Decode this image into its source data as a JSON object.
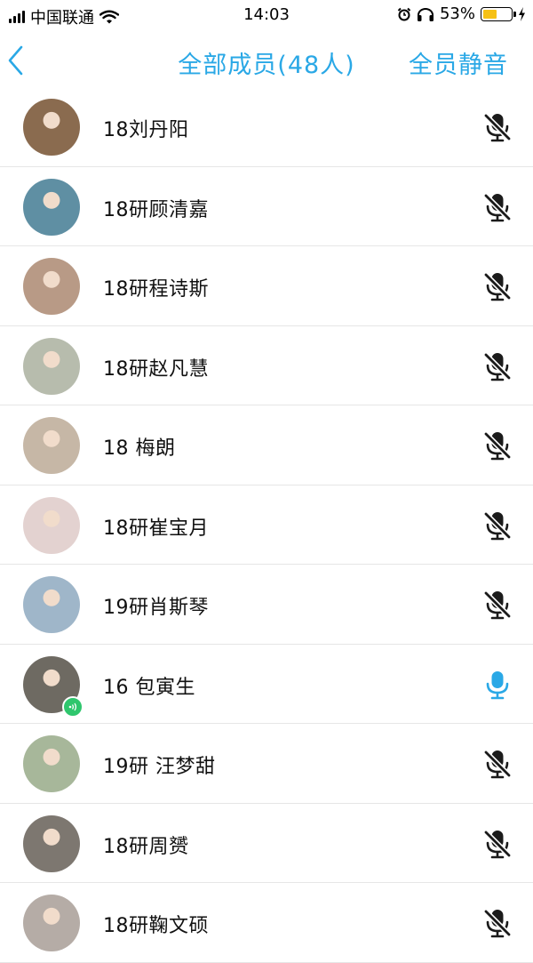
{
  "status_bar": {
    "carrier": "中国联通",
    "time": "14:03",
    "battery_percent": "53%",
    "battery_level": 0.53,
    "battery_color": "#f6c115",
    "icons": [
      "signal-icon",
      "wifi-icon",
      "alarm-icon",
      "headphones-icon",
      "battery-icon",
      "charging-bolt-icon"
    ]
  },
  "nav": {
    "back_icon": "chevron-left-icon",
    "title": "全部成员(48人)",
    "action_label": "全员静音",
    "accent_color": "#2aa8e6"
  },
  "members": [
    {
      "name": "18刘丹阳",
      "mic": "muted",
      "avatar_color": "#8a6b4f"
    },
    {
      "name": "18研顾清嘉",
      "mic": "muted",
      "avatar_color": "#5f8fa3"
    },
    {
      "name": "18研程诗斯",
      "mic": "muted",
      "avatar_color": "#b89a86"
    },
    {
      "name": "18研赵凡慧",
      "mic": "muted",
      "avatar_color": "#b7bcad"
    },
    {
      "name": "18 梅朗",
      "mic": "muted",
      "avatar_color": "#c6b7a6"
    },
    {
      "name": "18研崔宝月",
      "mic": "muted",
      "avatar_color": "#e3d2d0"
    },
    {
      "name": "19研肖斯琴",
      "mic": "muted",
      "avatar_color": "#9fb6c9"
    },
    {
      "name": "16 包寅生",
      "mic": "active",
      "speaking": true,
      "avatar_color": "#6e6a62"
    },
    {
      "name": "19研 汪梦甜",
      "mic": "muted",
      "avatar_color": "#a7b79a"
    },
    {
      "name": "18研周赟",
      "mic": "muted",
      "avatar_color": "#7d7770"
    },
    {
      "name": "18研鞠文硕",
      "mic": "muted",
      "avatar_color": "#b5aca6"
    }
  ],
  "mic_colors": {
    "muted": "#1b1b1b",
    "active": "#2aa8e6"
  }
}
